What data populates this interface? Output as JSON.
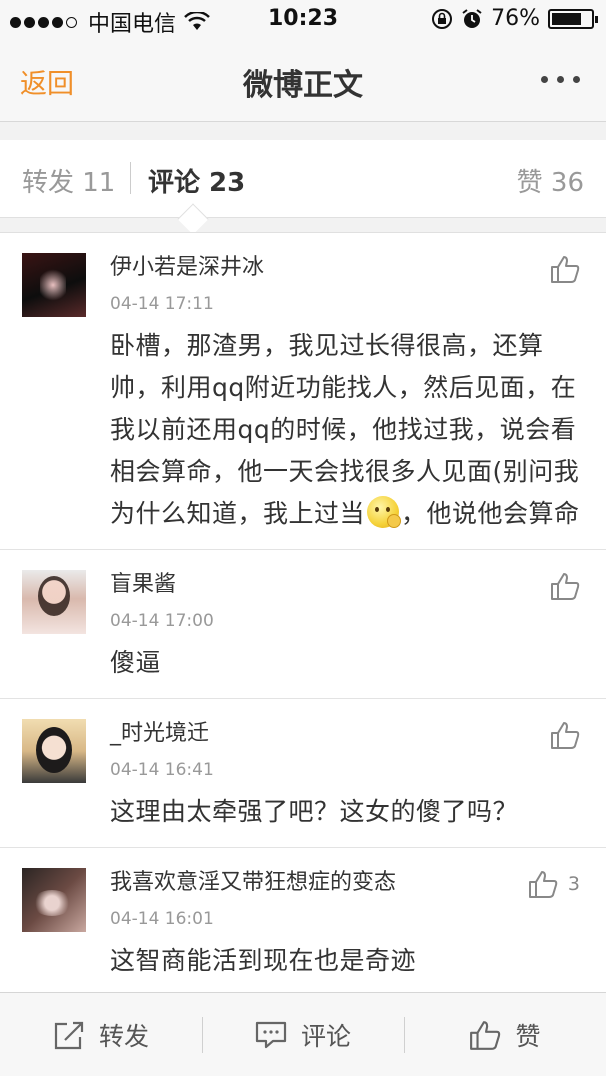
{
  "status_bar": {
    "carrier": "中国电信",
    "time": "10:23",
    "battery": "76%",
    "battery_level": 0.76,
    "signal_bars": 4,
    "icons": [
      "wifi-icon",
      "rotation-lock-icon",
      "alarm-icon",
      "battery-icon"
    ]
  },
  "nav": {
    "back_label": "返回",
    "title": "微博正文",
    "more_icon": "more-dots-icon"
  },
  "tabs": {
    "repost_label": "转发 11",
    "comment_label": "评论 23",
    "like_label": "赞 36"
  },
  "comments": [
    {
      "name": "伊小若是深井冰",
      "time": "04-14 17:11",
      "text_before_emoji": "卧槽，那渣男，我见过长得很高，还算帅，利用qq附近功能找人，然后见面，在我以前还用qq的时候，他找过我，说会看相会算命，他一天会找很多人见面(别问我为什么知道，我上过当",
      "text_after_emoji": "，他说他会算命",
      "emoji": "thinking-emoji",
      "likes": ""
    },
    {
      "name": "盲果酱",
      "time": "04-14 17:00",
      "text": "傻逼",
      "likes": ""
    },
    {
      "name": "_时光境迁",
      "time": "04-14 16:41",
      "text": "这理由太牵强了吧？这女的傻了吗？",
      "likes": ""
    },
    {
      "name": "我喜欢意淫又带狂想症的变态",
      "time": "04-14 16:01",
      "text": "这智商能活到现在也是奇迹",
      "likes": "3"
    }
  ],
  "toolbar": {
    "repost_label": "转发",
    "comment_label": "评论",
    "like_label": "赞"
  },
  "colors": {
    "accent": "#f08f29",
    "text_primary": "#333333",
    "text_secondary": "#999999"
  }
}
